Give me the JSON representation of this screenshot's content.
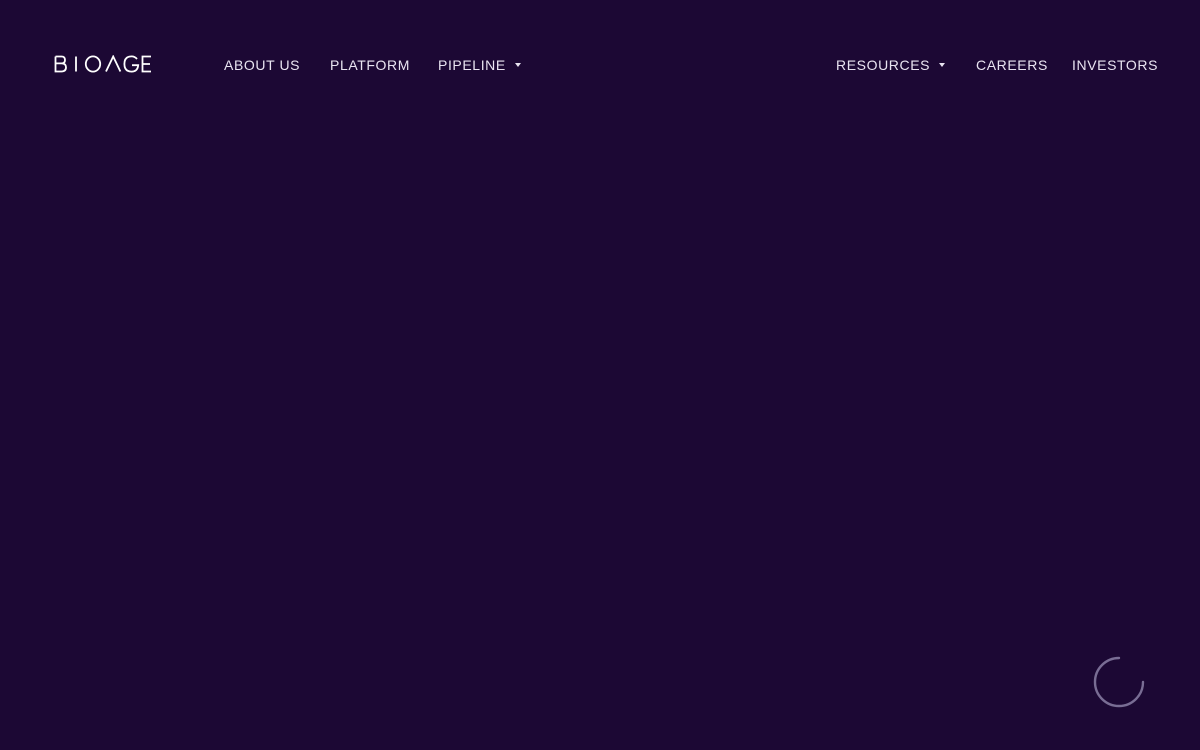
{
  "brand": {
    "logo_text": "BIOAGE",
    "logo_icon": "bioage-wordmark"
  },
  "nav": {
    "left_items": [
      {
        "label": "ABOUT US",
        "has_dropdown": false
      },
      {
        "label": "PLATFORM",
        "has_dropdown": false
      },
      {
        "label": "PIPELINE",
        "has_dropdown": true
      }
    ],
    "right_items": [
      {
        "label": "RESOURCES",
        "has_dropdown": true
      },
      {
        "label": "CAREERS",
        "has_dropdown": false
      },
      {
        "label": "INVESTORS",
        "has_dropdown": false
      }
    ]
  },
  "loading": {
    "icon": "loading-spinner-icon"
  },
  "colors": {
    "background": "#1c0834",
    "nav_text": "#e9e4f1",
    "spinner": "#8a7fa6"
  }
}
